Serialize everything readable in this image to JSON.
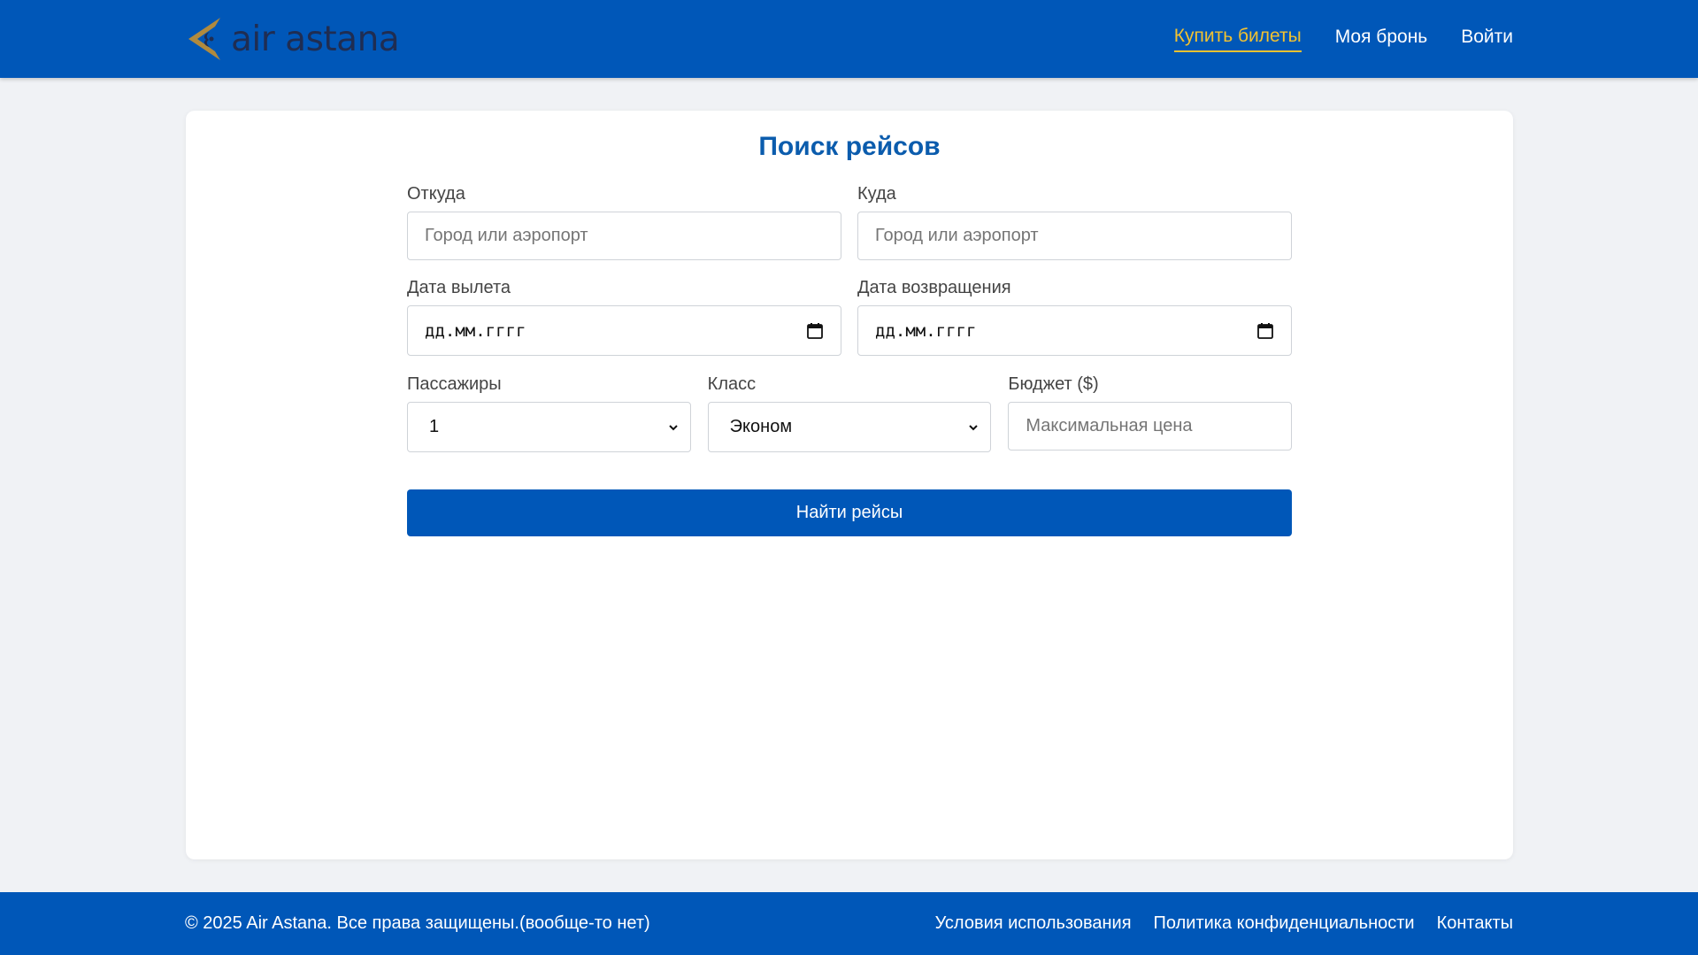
{
  "header": {
    "logo_text": "air astana",
    "nav": [
      {
        "label": "Купить билеты",
        "active": true
      },
      {
        "label": "Моя бронь",
        "active": false
      },
      {
        "label": "Войти",
        "active": false
      }
    ]
  },
  "search": {
    "title": "Поиск рейсов",
    "from": {
      "label": "Откуда",
      "placeholder": "Город или аэропорт"
    },
    "to": {
      "label": "Куда",
      "placeholder": "Город или аэропорт"
    },
    "departure": {
      "label": "Дата вылета",
      "value": "дд.мм.гггг"
    },
    "return": {
      "label": "Дата возвращения",
      "value": "дд.мм.гггг"
    },
    "passengers": {
      "label": "Пассажиры",
      "value": "1"
    },
    "class": {
      "label": "Класс",
      "value": "Эконом"
    },
    "budget": {
      "label": "Бюджет ($)",
      "placeholder": "Максимальная цена"
    },
    "submit_label": "Найти рейсы"
  },
  "footer": {
    "copyright": "© 2025 Air Astana. Все права защищены.(вообще-то нет)",
    "links": [
      "Условия использования",
      "Политика конфиденциальности",
      "Контакты"
    ]
  },
  "colors": {
    "primary": "#0057b8",
    "nav_active": "#f2c230",
    "title": "#0b5cad",
    "logo_text": "#1f2d52",
    "logo_mark": "#b08a3e"
  }
}
